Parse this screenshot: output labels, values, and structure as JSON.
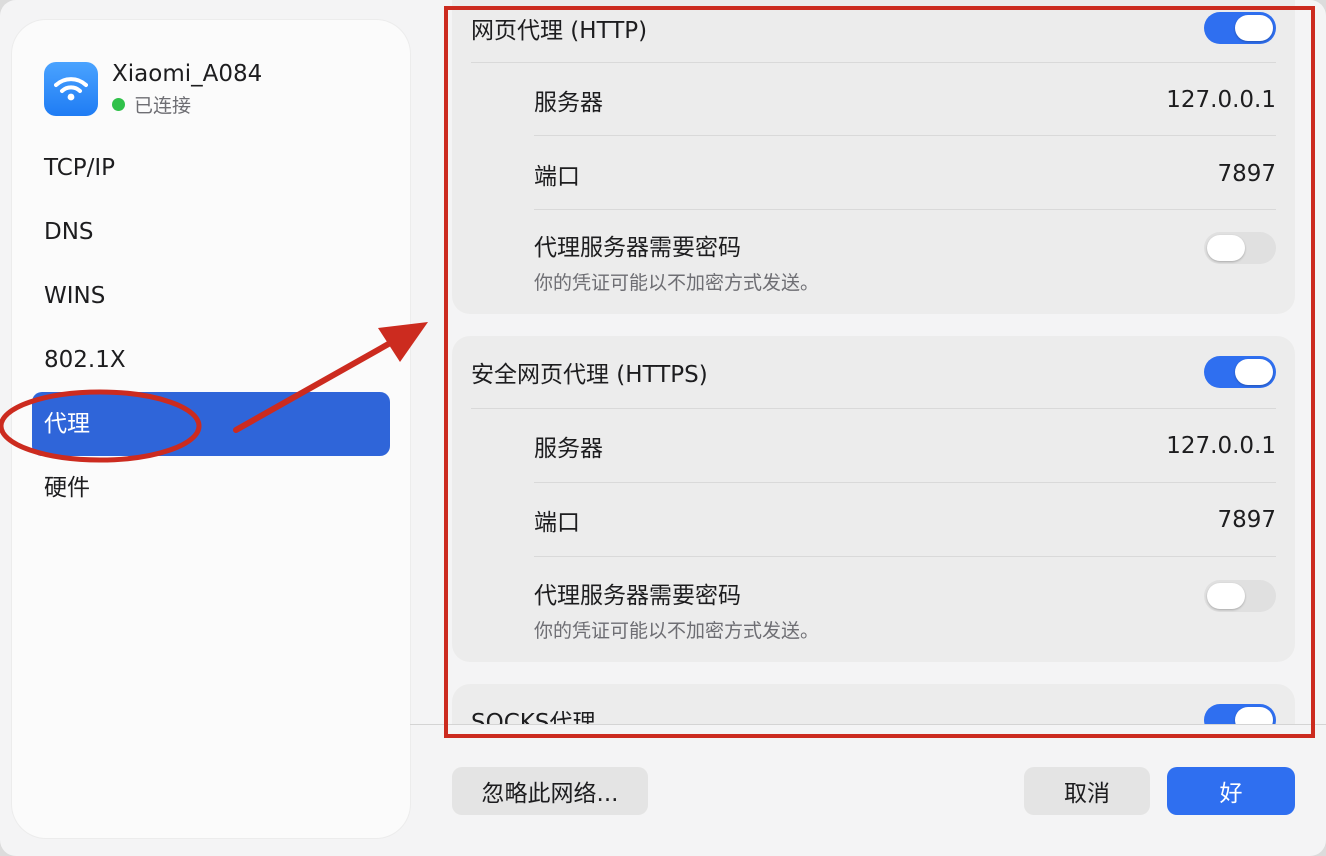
{
  "network": {
    "name": "Xiaomi_A084",
    "status": "已连接",
    "icon": "wifi-icon",
    "status_color": "#30c14a"
  },
  "sidebar": {
    "items": [
      {
        "label": "TCP/IP",
        "selected": false
      },
      {
        "label": "DNS",
        "selected": false
      },
      {
        "label": "WINS",
        "selected": false
      },
      {
        "label": "802.1X",
        "selected": false
      },
      {
        "label": "代理",
        "selected": true
      },
      {
        "label": "硬件",
        "selected": false
      }
    ]
  },
  "http_proxy": {
    "title": "网页代理 (HTTP)",
    "enabled": true,
    "server_label": "服务器",
    "server_value": "127.0.0.1",
    "port_label": "端口",
    "port_value": "7897",
    "password_label": "代理服务器需要密码",
    "password_note": "你的凭证可能以不加密方式发送。",
    "password_enabled": false
  },
  "https_proxy": {
    "title": "安全网页代理 (HTTPS)",
    "enabled": true,
    "server_label": "服务器",
    "server_value": "127.0.0.1",
    "port_label": "端口",
    "port_value": "7897",
    "password_label": "代理服务器需要密码",
    "password_note": "你的凭证可能以不加密方式发送。",
    "password_enabled": false
  },
  "socks_proxy": {
    "title": "SOCKS代理",
    "enabled": true
  },
  "footer": {
    "forget_label": "忽略此网络...",
    "cancel_label": "取消",
    "ok_label": "好"
  },
  "colors": {
    "accent": "#2f6ff0",
    "selection": "#2f65d9",
    "annotation": "#cc2b1f"
  }
}
